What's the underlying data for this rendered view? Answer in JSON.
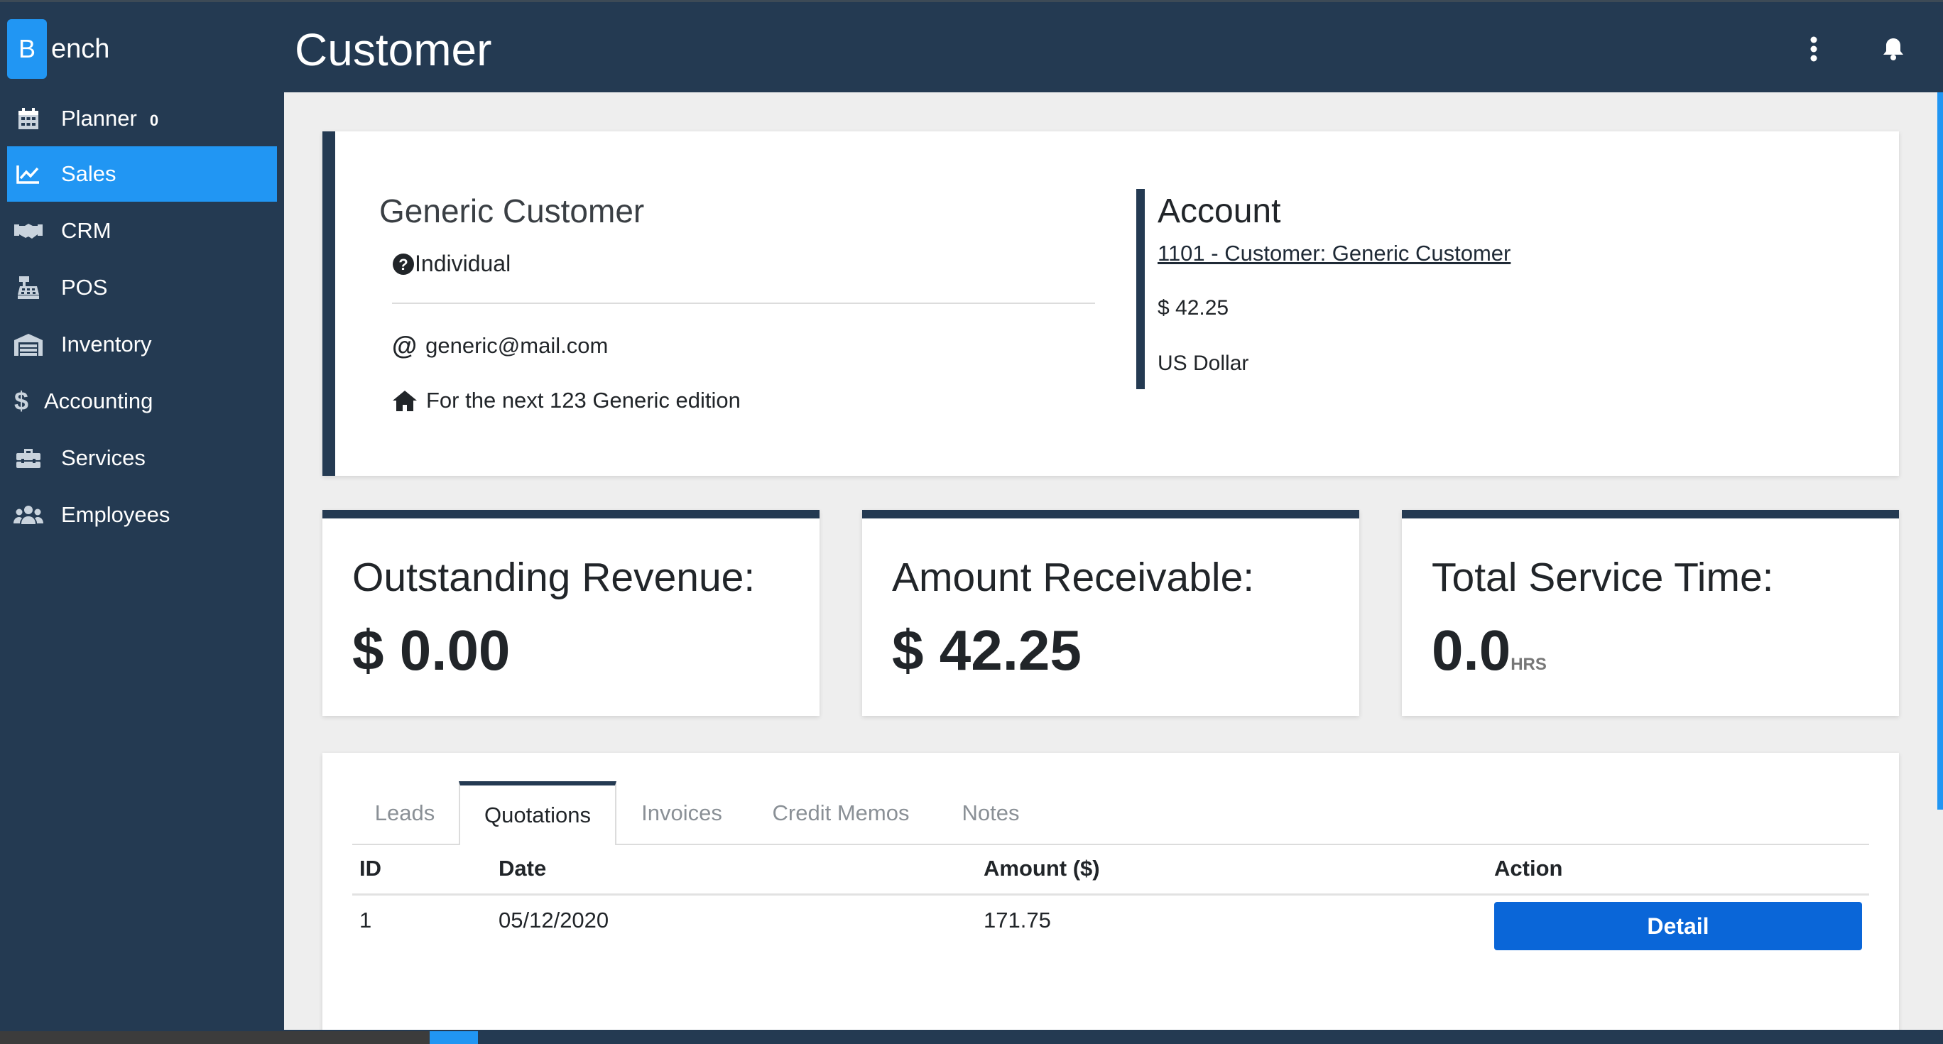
{
  "brand": {
    "badge": "B",
    "text": "ench",
    "accent": "#2196f3",
    "navy": "#243a52"
  },
  "header": {
    "title": "Customer",
    "icons": [
      "more-vertical-icon",
      "bell-icon"
    ]
  },
  "sidebar": {
    "items": [
      {
        "label": "Planner",
        "badge": "0",
        "icon": "calendar-icon",
        "active": false
      },
      {
        "label": "Sales",
        "icon": "chart-line-icon",
        "active": true
      },
      {
        "label": "CRM",
        "icon": "handshake-icon",
        "active": false
      },
      {
        "label": "POS",
        "icon": "cash-register-icon",
        "active": false
      },
      {
        "label": "Inventory",
        "icon": "warehouse-icon",
        "active": false
      },
      {
        "label": "Accounting",
        "icon": "dollar-icon",
        "active": false
      },
      {
        "label": "Services",
        "icon": "toolbox-icon",
        "active": false
      },
      {
        "label": "Employees",
        "icon": "users-icon",
        "active": false
      }
    ]
  },
  "customer": {
    "name": "Generic Customer",
    "type": "Individual",
    "email": "generic@mail.com",
    "address": "For the next 123 Generic edition"
  },
  "account": {
    "title": "Account",
    "link": "1101 - Customer: Generic Customer",
    "balance": "$ 42.25",
    "currency": "US Dollar"
  },
  "stats": [
    {
      "title": "Outstanding Revenue:",
      "value": "$ 0.00",
      "unit": ""
    },
    {
      "title": "Amount Receivable:",
      "value": "$ 42.25",
      "unit": ""
    },
    {
      "title": "Total Service Time:",
      "value": "0.0",
      "unit": "HRS"
    }
  ],
  "tabs": [
    {
      "label": "Leads",
      "active": false
    },
    {
      "label": "Quotations",
      "active": true
    },
    {
      "label": "Invoices",
      "active": false
    },
    {
      "label": "Credit Memos",
      "active": false
    },
    {
      "label": "Notes",
      "active": false
    }
  ],
  "table": {
    "headers": [
      "ID",
      "Date",
      "Amount ($)",
      "Action"
    ],
    "rows": [
      {
        "id": "1",
        "date": "05/12/2020",
        "amount": "171.75",
        "action": "Detail"
      }
    ]
  }
}
